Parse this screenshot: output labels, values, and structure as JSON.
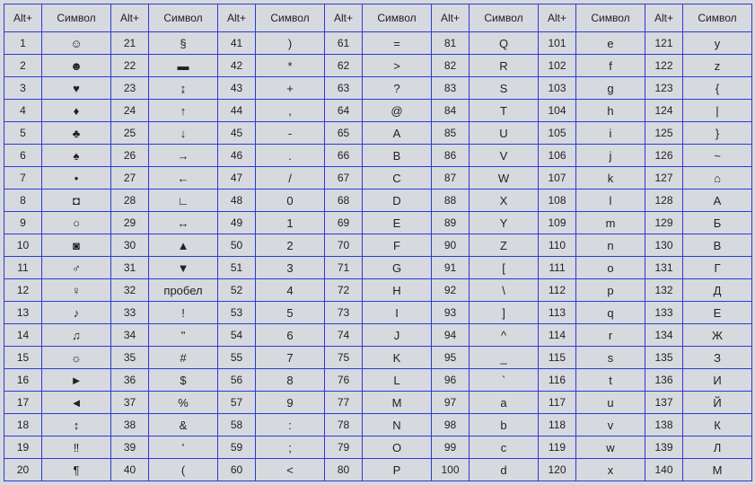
{
  "headers": {
    "alt": "Alt+",
    "symbol": "Символ"
  },
  "columns": [
    [
      {
        "code": "1",
        "sym": "☺"
      },
      {
        "code": "2",
        "sym": "☻"
      },
      {
        "code": "3",
        "sym": "♥"
      },
      {
        "code": "4",
        "sym": "♦"
      },
      {
        "code": "5",
        "sym": "♣"
      },
      {
        "code": "6",
        "sym": "♠"
      },
      {
        "code": "7",
        "sym": "•"
      },
      {
        "code": "8",
        "sym": "◘"
      },
      {
        "code": "9",
        "sym": "○"
      },
      {
        "code": "10",
        "sym": "◙"
      },
      {
        "code": "11",
        "sym": "♂"
      },
      {
        "code": "12",
        "sym": "♀"
      },
      {
        "code": "13",
        "sym": "♪"
      },
      {
        "code": "14",
        "sym": "♫"
      },
      {
        "code": "15",
        "sym": "☼"
      },
      {
        "code": "16",
        "sym": "►"
      },
      {
        "code": "17",
        "sym": "◄"
      },
      {
        "code": "18",
        "sym": "↕"
      },
      {
        "code": "19",
        "sym": "‼"
      },
      {
        "code": "20",
        "sym": "¶"
      }
    ],
    [
      {
        "code": "21",
        "sym": "§"
      },
      {
        "code": "22",
        "sym": "▬"
      },
      {
        "code": "23",
        "sym": "↨"
      },
      {
        "code": "24",
        "sym": "↑"
      },
      {
        "code": "25",
        "sym": "↓"
      },
      {
        "code": "26",
        "sym": "→"
      },
      {
        "code": "27",
        "sym": "←"
      },
      {
        "code": "28",
        "sym": "∟"
      },
      {
        "code": "29",
        "sym": "↔"
      },
      {
        "code": "30",
        "sym": "▲"
      },
      {
        "code": "31",
        "sym": "▼"
      },
      {
        "code": "32",
        "sym": "пробел"
      },
      {
        "code": "33",
        "sym": "!"
      },
      {
        "code": "34",
        "sym": "\""
      },
      {
        "code": "35",
        "sym": "#"
      },
      {
        "code": "36",
        "sym": "$"
      },
      {
        "code": "37",
        "sym": "%"
      },
      {
        "code": "38",
        "sym": "&"
      },
      {
        "code": "39",
        "sym": "'"
      },
      {
        "code": "40",
        "sym": "("
      }
    ],
    [
      {
        "code": "41",
        "sym": ")"
      },
      {
        "code": "42",
        "sym": "*"
      },
      {
        "code": "43",
        "sym": "+"
      },
      {
        "code": "44",
        "sym": ","
      },
      {
        "code": "45",
        "sym": "-"
      },
      {
        "code": "46",
        "sym": "."
      },
      {
        "code": "47",
        "sym": "/"
      },
      {
        "code": "48",
        "sym": "0"
      },
      {
        "code": "49",
        "sym": "1"
      },
      {
        "code": "50",
        "sym": "2"
      },
      {
        "code": "51",
        "sym": "3"
      },
      {
        "code": "52",
        "sym": "4"
      },
      {
        "code": "53",
        "sym": "5"
      },
      {
        "code": "54",
        "sym": "6"
      },
      {
        "code": "55",
        "sym": "7"
      },
      {
        "code": "56",
        "sym": "8"
      },
      {
        "code": "57",
        "sym": "9"
      },
      {
        "code": "58",
        "sym": ":"
      },
      {
        "code": "59",
        "sym": ";"
      },
      {
        "code": "60",
        "sym": "<"
      }
    ],
    [
      {
        "code": "61",
        "sym": "="
      },
      {
        "code": "62",
        "sym": ">"
      },
      {
        "code": "63",
        "sym": "?"
      },
      {
        "code": "64",
        "sym": "@"
      },
      {
        "code": "65",
        "sym": "A"
      },
      {
        "code": "66",
        "sym": "B"
      },
      {
        "code": "67",
        "sym": "C"
      },
      {
        "code": "68",
        "sym": "D"
      },
      {
        "code": "69",
        "sym": "E"
      },
      {
        "code": "70",
        "sym": "F"
      },
      {
        "code": "71",
        "sym": "G"
      },
      {
        "code": "72",
        "sym": "H"
      },
      {
        "code": "73",
        "sym": "I"
      },
      {
        "code": "74",
        "sym": "J"
      },
      {
        "code": "75",
        "sym": "K"
      },
      {
        "code": "76",
        "sym": "L"
      },
      {
        "code": "77",
        "sym": "M"
      },
      {
        "code": "78",
        "sym": "N"
      },
      {
        "code": "79",
        "sym": "O"
      },
      {
        "code": "80",
        "sym": "P"
      }
    ],
    [
      {
        "code": "81",
        "sym": "Q"
      },
      {
        "code": "82",
        "sym": "R"
      },
      {
        "code": "83",
        "sym": "S"
      },
      {
        "code": "84",
        "sym": "T"
      },
      {
        "code": "85",
        "sym": "U"
      },
      {
        "code": "86",
        "sym": "V"
      },
      {
        "code": "87",
        "sym": "W"
      },
      {
        "code": "88",
        "sym": "X"
      },
      {
        "code": "89",
        "sym": "Y"
      },
      {
        "code": "90",
        "sym": "Z"
      },
      {
        "code": "91",
        "sym": "["
      },
      {
        "code": "92",
        "sym": "\\"
      },
      {
        "code": "93",
        "sym": "]"
      },
      {
        "code": "94",
        "sym": "^"
      },
      {
        "code": "95",
        "sym": "_"
      },
      {
        "code": "96",
        "sym": "`"
      },
      {
        "code": "97",
        "sym": "a"
      },
      {
        "code": "98",
        "sym": "b"
      },
      {
        "code": "99",
        "sym": "c"
      },
      {
        "code": "100",
        "sym": "d"
      }
    ],
    [
      {
        "code": "101",
        "sym": "e"
      },
      {
        "code": "102",
        "sym": "f"
      },
      {
        "code": "103",
        "sym": "g"
      },
      {
        "code": "104",
        "sym": "h"
      },
      {
        "code": "105",
        "sym": "i"
      },
      {
        "code": "106",
        "sym": "j"
      },
      {
        "code": "107",
        "sym": "k"
      },
      {
        "code": "108",
        "sym": "l"
      },
      {
        "code": "109",
        "sym": "m"
      },
      {
        "code": "110",
        "sym": "n"
      },
      {
        "code": "111",
        "sym": "o"
      },
      {
        "code": "112",
        "sym": "p"
      },
      {
        "code": "113",
        "sym": "q"
      },
      {
        "code": "114",
        "sym": "r"
      },
      {
        "code": "115",
        "sym": "s"
      },
      {
        "code": "116",
        "sym": "t"
      },
      {
        "code": "117",
        "sym": "u"
      },
      {
        "code": "118",
        "sym": "v"
      },
      {
        "code": "119",
        "sym": "w"
      },
      {
        "code": "120",
        "sym": "x"
      }
    ],
    [
      {
        "code": "121",
        "sym": "y"
      },
      {
        "code": "122",
        "sym": "z"
      },
      {
        "code": "123",
        "sym": "{"
      },
      {
        "code": "124",
        "sym": "|"
      },
      {
        "code": "125",
        "sym": "}"
      },
      {
        "code": "126",
        "sym": "~"
      },
      {
        "code": "127",
        "sym": "⌂"
      },
      {
        "code": "128",
        "sym": "А"
      },
      {
        "code": "129",
        "sym": "Б"
      },
      {
        "code": "130",
        "sym": "В"
      },
      {
        "code": "131",
        "sym": "Г"
      },
      {
        "code": "132",
        "sym": "Д"
      },
      {
        "code": "133",
        "sym": "Е"
      },
      {
        "code": "134",
        "sym": "Ж"
      },
      {
        "code": "135",
        "sym": "З"
      },
      {
        "code": "136",
        "sym": "И"
      },
      {
        "code": "137",
        "sym": "Й"
      },
      {
        "code": "138",
        "sym": "К"
      },
      {
        "code": "139",
        "sym": "Л"
      },
      {
        "code": "140",
        "sym": "М"
      }
    ]
  ]
}
